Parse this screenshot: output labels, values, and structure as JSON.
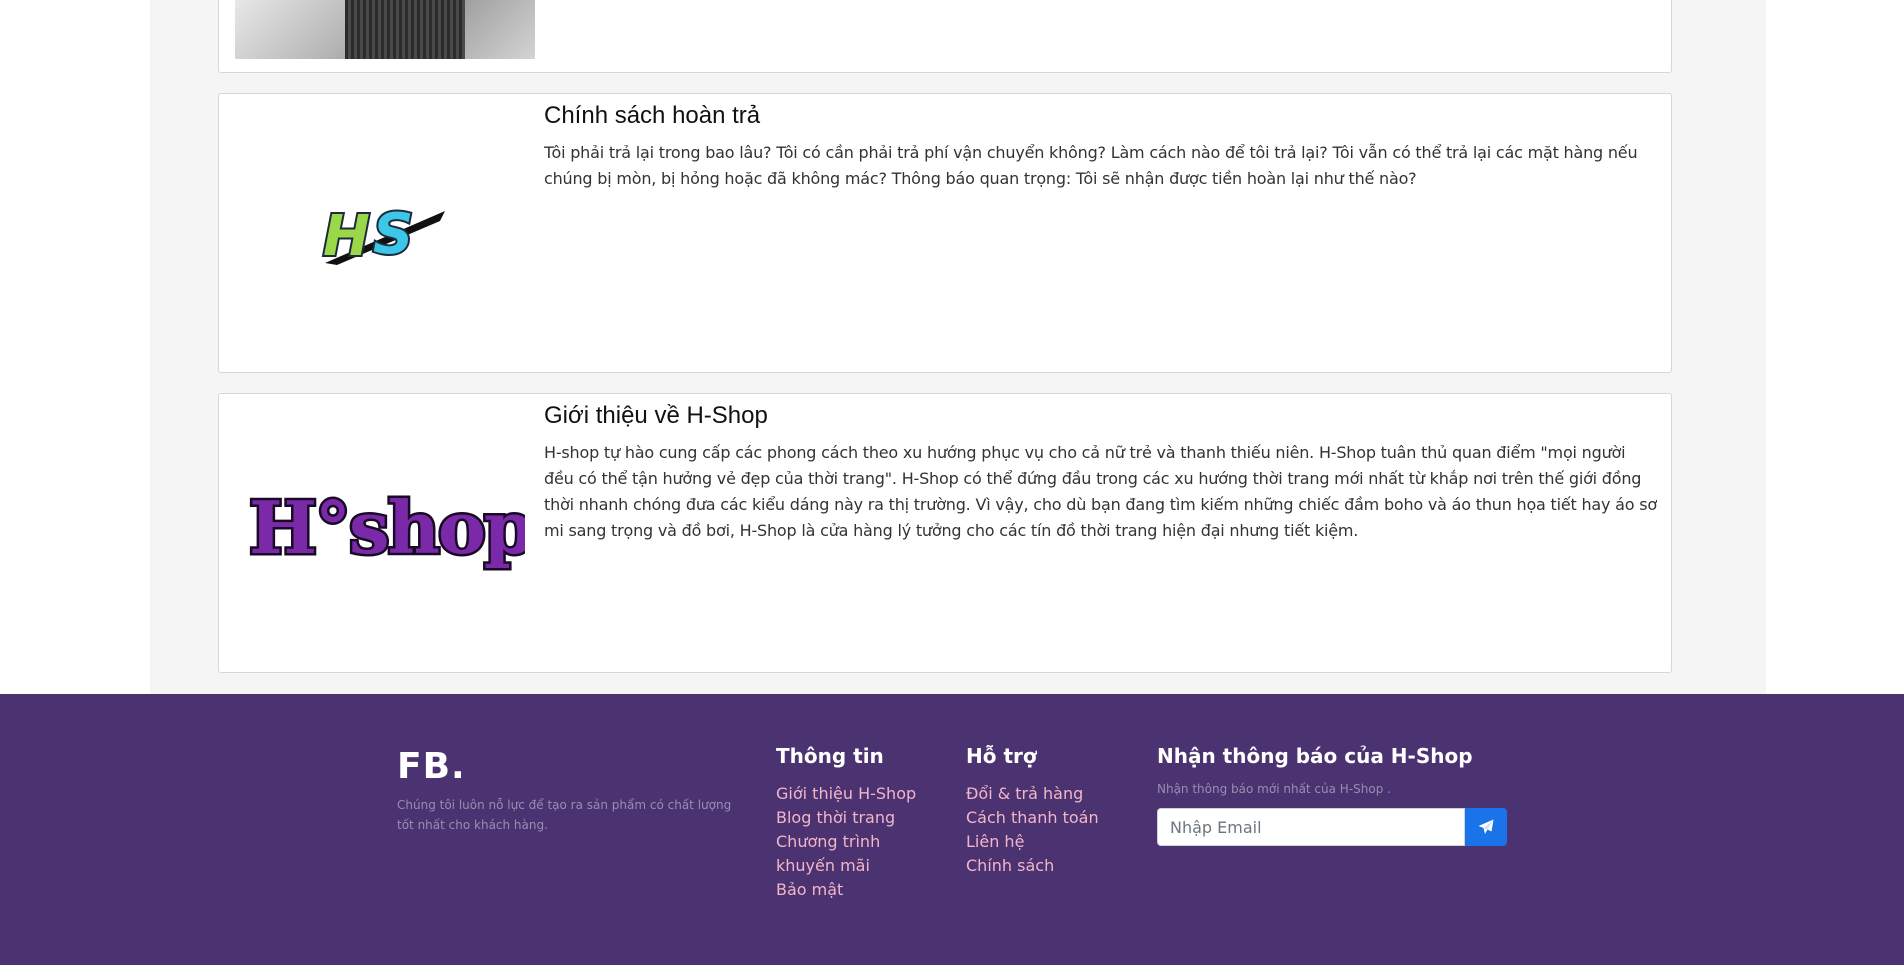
{
  "cards": [
    {
      "title": "Chính sách hoàn trả",
      "text": "Tôi phải trả lại trong bao lâu? Tôi có cần phải trả phí vận chuyển không? Làm cách nào để tôi trả lại? Tôi vẫn có thể trả lại các mặt hàng nếu chúng bị mòn, bị hỏng hoặc đã không mác? Thông báo quan trọng: Tôi sẽ nhận được tiền hoàn lại như thế nào?",
      "logo_text": "HS"
    },
    {
      "title": "Giới thiệu về H-Shop",
      "text": "H-shop tự hào cung cấp các phong cách theo xu hướng phục vụ cho cả nữ trẻ và thanh thiếu niên. H-Shop tuân thủ quan điểm \"mọi người đều có thể tận hưởng vẻ đẹp của thời trang\". H-Shop có thể đứng đầu trong các xu hướng thời trang mới nhất từ khắp nơi trên thế giới đồng thời nhanh chóng đưa các kiểu dáng này ra thị trường. Vì vậy, cho dù bạn đang tìm kiếm những chiếc đầm boho và áo thun họa tiết hay áo sơ mi sang trọng và đồ bơi, H-Shop là cửa hàng lý tưởng cho các tín đồ thời trang hiện đại nhưng tiết kiệm.",
      "logo_text": "H°shop"
    }
  ],
  "footer": {
    "brand": "FB.",
    "brand_desc": "Chúng tôi luôn nỗ lực để tạo ra sản phẩm có chất lượng tốt nhất cho khách hàng.",
    "info": {
      "heading": "Thông tin",
      "links": [
        "Giới thiệu H-Shop",
        "Blog thời trang",
        "Chương trình khuyến mãi",
        "Bảo mật"
      ]
    },
    "help": {
      "heading": "Hỗ trợ",
      "links": [
        "Đổi & trả hàng",
        "Cách thanh toán",
        "Liên hệ",
        "Chính sách"
      ]
    },
    "newsletter": {
      "heading": "Nhận thông báo của H-Shop",
      "desc": "Nhận thông báo mới nhất của H-Shop .",
      "placeholder": "Nhập Email",
      "send_icon": "paper-plane-icon"
    }
  },
  "colors": {
    "footer_bg": "#4b3271",
    "link": "#f3b6c7",
    "accent": "#1a73e8"
  }
}
